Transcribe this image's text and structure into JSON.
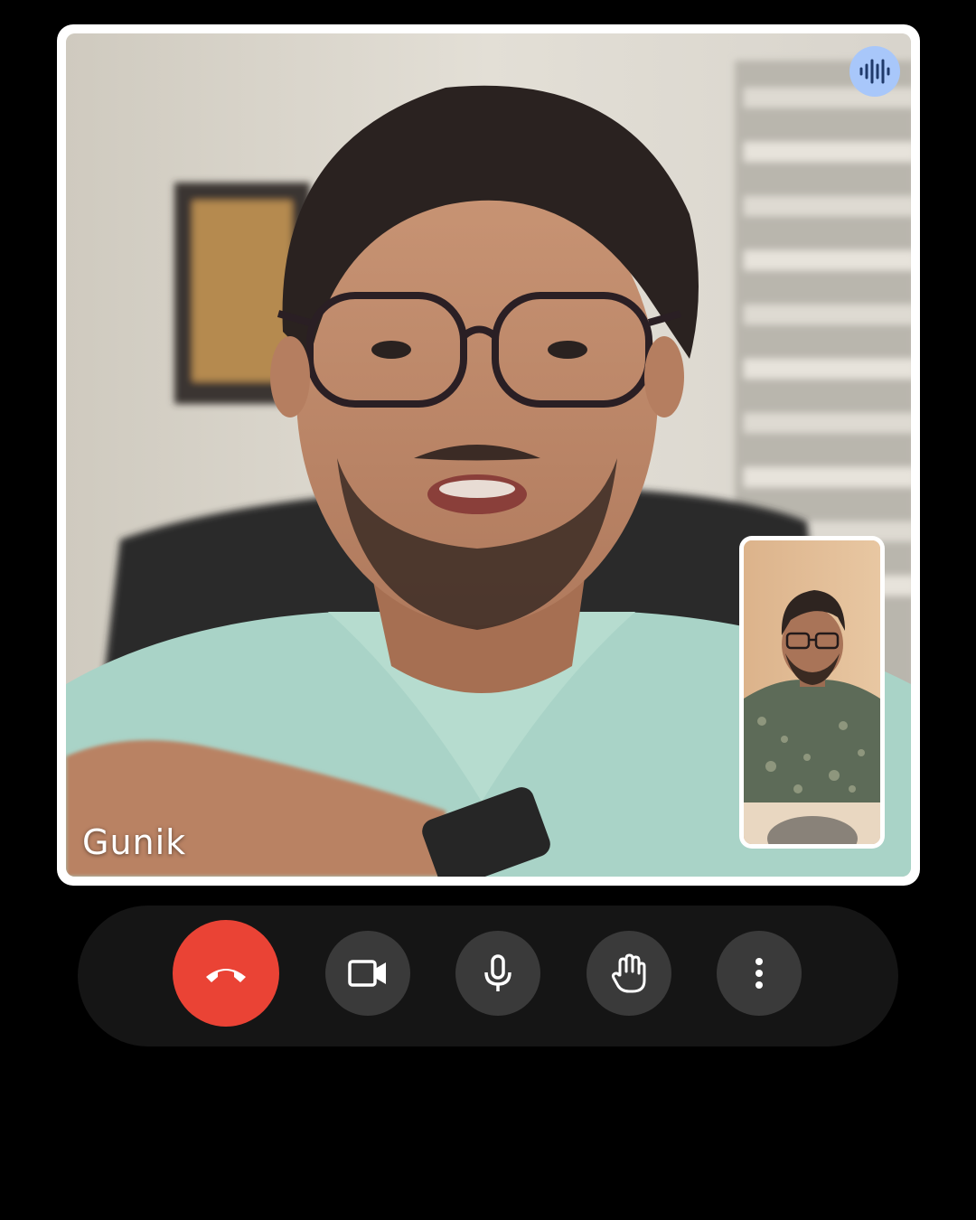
{
  "call": {
    "main_participant": {
      "name": "Gunik",
      "speaking": true
    },
    "self_view": {
      "visible": true
    }
  },
  "controls": [
    {
      "id": "end-call",
      "icon": "phone-hangup-icon",
      "color": "#ea4335"
    },
    {
      "id": "camera",
      "icon": "video-camera-icon"
    },
    {
      "id": "microphone",
      "icon": "microphone-icon"
    },
    {
      "id": "raise-hand",
      "icon": "hand-icon"
    },
    {
      "id": "more-options",
      "icon": "more-vertical-icon"
    }
  ],
  "colors": {
    "background": "#000000",
    "tile_border": "#ffffff",
    "control_bar": "#151515",
    "control_button": "#3a3a3a",
    "end_call": "#ea4335",
    "speaking_indicator": "#a8c7fa"
  }
}
